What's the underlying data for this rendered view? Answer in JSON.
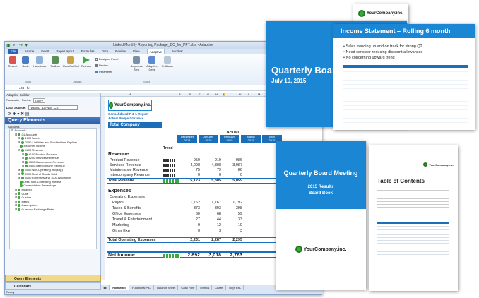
{
  "excel": {
    "title": "Linked Monthly Reporting Package_DC_for_PPT.xlsx - Adaptive",
    "tabs": [
      "File",
      "Home",
      "Insert",
      "Page Layout",
      "Formulas",
      "Data",
      "Review",
      "View",
      "Adaptive",
      "Acrobat"
    ],
    "ribbon": {
      "recent": "Recent",
      "book": "Book",
      "handbook": "Handbook",
      "properties": "Properties",
      "toolbox": "Toolbox",
      "row_col_cell": "Row/Col/Cell",
      "refresh": "Refresh",
      "designer_panel": "Designer Panel",
      "review": "Review",
      "parameter": "Parameter",
      "suppress_zero": "Suppress Zero",
      "adaptive_cells": "Adaptive Cells",
      "drilldown": "Drilldown",
      "group_book": "Book",
      "group_design": "Design",
      "group_show": "Show"
    },
    "cell_ref": "J48",
    "status": "Ready"
  },
  "pane": {
    "title": "Adaptive Builder",
    "tabs": [
      "Parameter",
      "Review",
      "Query"
    ],
    "data_source_label": "Data Source:",
    "data_source_value": "DEMO_LEWIS_CS",
    "query_elements": "Query Elements",
    "accounts_tab": "Accounts",
    "tree": [
      "Accounts",
      "GL Accounts",
      "1000 Assets",
      "2000 Liabilities and Stockholders Equities",
      "3900 Net Income",
      "4000 Revenue",
      "4100 Product Revenue",
      "4200 Services Revenue",
      "4300 Maintenance Revenue",
      "4400 Intercompany Revenue",
      "5100 Non-Operating Inc/(Exp)",
      "5300 Cost of Goods Sold",
      "6000 Expenses and 7000 Allocations",
      "Less: Non-Controlling Interest",
      "Consolidation Percentage",
      "Modeled",
      "Cube",
      "Custom",
      "Metric",
      "Assumptions",
      "Currency Exchange Rates"
    ],
    "footer_query": "Query Elements",
    "footer_calendars": "Calendars"
  },
  "sheet": {
    "columns": [
      "A",
      "B",
      "E",
      "F",
      "G",
      "H",
      "I",
      "J",
      "K",
      "L",
      "M",
      "N",
      "O",
      "P"
    ],
    "logo_text": "YourCompany.inc.",
    "report_line1": "Consolidated P & L Report",
    "report_line2": "Actual Budget/Variance",
    "company": "Total Company",
    "actuals": "Actuals",
    "budget": "Budget",
    "actual": "Actual",
    "months": [
      "December",
      "January",
      "February",
      "March",
      "April"
    ],
    "years": [
      "2014",
      "2015",
      "2015",
      "2015",
      "2015"
    ],
    "extra_month": "April",
    "extra_year": "2014",
    "trend": "Trend",
    "revenue_title": "Revenue",
    "revenue_rows": [
      {
        "label": "Product Revenue",
        "dollar": "$",
        "v": [
          "950",
          "919",
          "986"
        ]
      },
      {
        "label": "Services Revenue",
        "dollar": "",
        "v": [
          "4,098",
          "4,308",
          "3,987"
        ]
      },
      {
        "label": "Maintenance Revenue",
        "dollar": "",
        "v": [
          "75",
          "79",
          "86"
        ]
      },
      {
        "label": "Intercompany Revenue",
        "dollar": "",
        "v": [
          "0",
          "0",
          "0"
        ]
      }
    ],
    "total_revenue": {
      "label": "Total Revenue",
      "v": [
        "5,123",
        "5,305",
        "5,059"
      ]
    },
    "expenses_title": "Expenses",
    "opex_label": "Operating Expenses",
    "expense_rows": [
      {
        "label": "Payroll",
        "v": [
          "1,762",
          "1,767",
          "1,792"
        ]
      },
      {
        "label": "Taxes & Benefits",
        "v": [
          "373",
          "393",
          "398"
        ]
      },
      {
        "label": "Office Expenses",
        "v": [
          "60",
          "68",
          "59"
        ]
      },
      {
        "label": "Travel & Entertainment",
        "v": [
          "27",
          "44",
          "33"
        ]
      },
      {
        "label": "Marketing",
        "v": [
          "9",
          "12",
          "10"
        ]
      },
      {
        "label": "Other Exp",
        "v": [
          "0",
          "3",
          "3"
        ]
      }
    ],
    "total_opex": {
      "label": "Total Operating Expenses",
      "v": [
        "2,231",
        "2,287",
        "2,295"
      ]
    },
    "net_income": {
      "label": "Net Income",
      "v": [
        "2,892",
        "3,018",
        "2,763"
      ]
    },
    "row_numbers": [
      "1",
      "2",
      "3",
      "4",
      "5",
      "6",
      "7",
      "8",
      "9",
      "10",
      "11",
      "12",
      "13",
      "14",
      "15",
      "16",
      "17",
      "18",
      "19",
      "20",
      "21",
      "22",
      "23",
      "24",
      "25",
      "26",
      "27",
      "28",
      "29"
    ],
    "sheet_tabs": [
      "Formatted",
      "Functional P&L",
      "Balance Sheet",
      "Cash Flow",
      "Metrics",
      "Charts",
      "Dept P&L"
    ]
  },
  "slides": {
    "logo_text": "YourCompany.inc.",
    "title_slide_title": "Quarterly Board Meeting",
    "title_slide_date": "July 10, 2015",
    "income_title": "Income Statement – Rolling 6 month",
    "income_bullets": [
      "Sales trending up and on track for strong Q2",
      "Need consider reducing discount allowances",
      "No concerning upward trend"
    ],
    "cover_title": "Quarterly Board Meeting",
    "cover_sub1": "2015 Results",
    "cover_sub2": "Board Book",
    "toc_title": "Table of Contents"
  },
  "colors": {
    "accent": "#1a86d4",
    "green": "#3aa83a"
  }
}
